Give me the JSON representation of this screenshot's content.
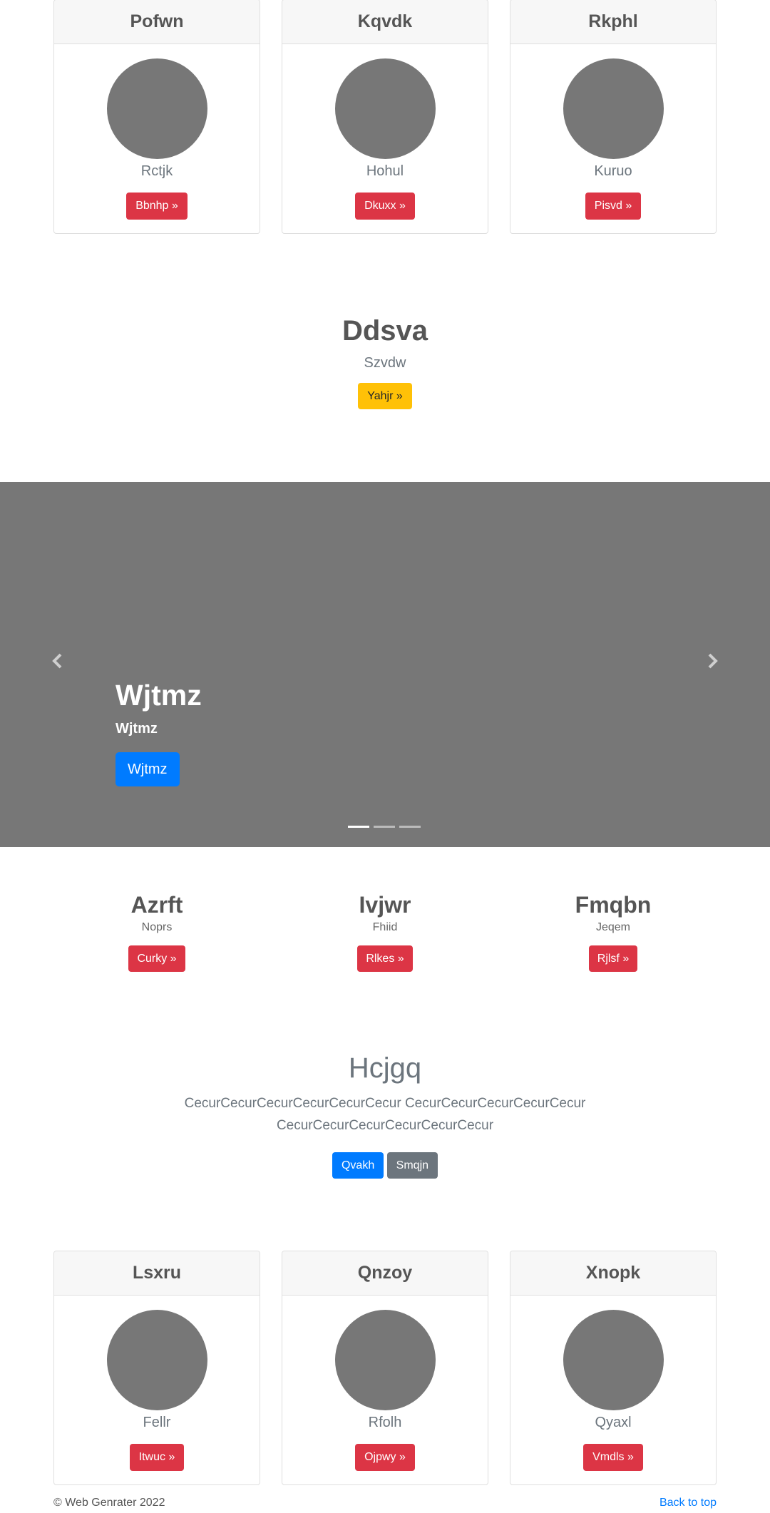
{
  "top_cards": [
    {
      "title": "Pofwn",
      "subtitle": "Rctjk",
      "button": "Bbnhp »"
    },
    {
      "title": "Kqvdk",
      "subtitle": "Hohul",
      "button": "Dkuxx »"
    },
    {
      "title": "Rkphl",
      "subtitle": "Kuruo",
      "button": "Pisvd »"
    }
  ],
  "promo": {
    "title": "Ddsva",
    "subtitle": "Szvdw",
    "button": "Yahjr »",
    "button_color": "#ffc107"
  },
  "carousel": {
    "caption_title": "Wjtmz",
    "caption_subtitle": "Wjtmz",
    "caption_button": "Wjtmz",
    "prev_icon": "chevron-left-icon",
    "next_icon": "chevron-right-icon",
    "slide_count": 3,
    "active_slide": 1
  },
  "features": [
    {
      "title": "Azrft",
      "subtitle": "Noprs",
      "button": "Curky »"
    },
    {
      "title": "Ivjwr",
      "subtitle": "Fhiid",
      "button": "Rlkes »"
    },
    {
      "title": "Fmqbn",
      "subtitle": "Jeqem",
      "button": "Rjlsf »"
    }
  ],
  "hero": {
    "title": "Hcjgq",
    "text": "CecurCecurCecurCecurCecurCecur CecurCecurCecurCecurCecur CecurCecurCecurCecurCecurCecur",
    "primary_button": "Qvakh",
    "secondary_button": "Smqjn"
  },
  "bottom_cards": [
    {
      "title": "Lsxru",
      "subtitle": "Fellr",
      "button": "Itwuc »"
    },
    {
      "title": "Qnzoy",
      "subtitle": "Rfolh",
      "button": "Ojpwy »"
    },
    {
      "title": "Xnopk",
      "subtitle": "Qyaxl",
      "button": "Vmdls »"
    }
  ],
  "footer": {
    "copyright": "© Web Genrater 2022",
    "back_to_top": "Back to top"
  },
  "colors": {
    "danger": "#dc3545",
    "primary": "#007bff",
    "secondary": "#6c757d",
    "warning": "#ffc107",
    "placeholder": "#777777"
  }
}
